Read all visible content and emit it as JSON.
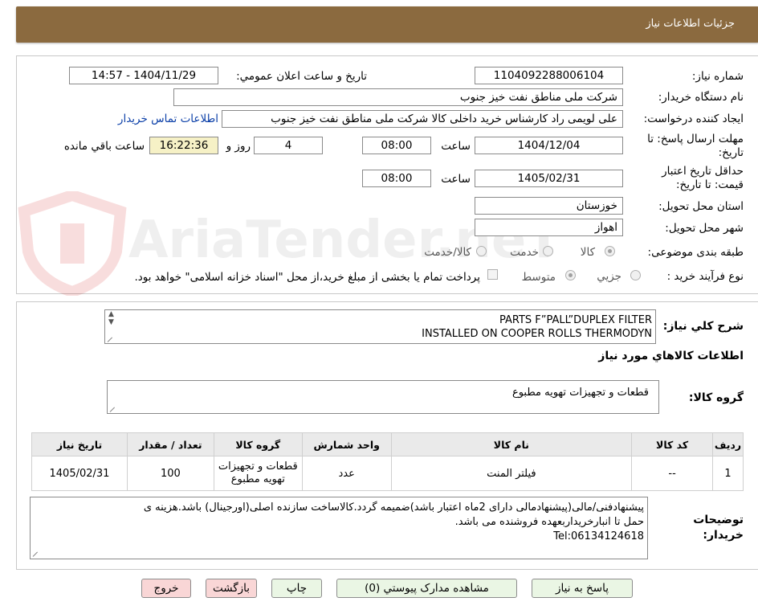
{
  "header": {
    "title": "جزئيات اطلاعات نياز"
  },
  "form": {
    "need_number": {
      "label": "شماره نياز:",
      "value": "1104092288006104"
    },
    "announce": {
      "label": "تاريخ و ساعت اعلان عمومي:",
      "value": "1404/11/29 - 14:57"
    },
    "buyer_org": {
      "label": "نام دستگاه خريدار:",
      "value": "شرکت ملی مناطق نفت خیز جنوب"
    },
    "requester": {
      "label": "ايجاد کننده درخواست:",
      "value": "علی  لویمی راد  کارشناس خرید داخلی کالا شرکت ملی مناطق نفت خیز جنوب",
      "contact_link": "اطلاعات تماس خريدار"
    },
    "deadline": {
      "label": "مهلت ارسال پاسخ: تا تاريخ:",
      "date": "1404/12/04",
      "time_label": "ساعت",
      "time": "08:00",
      "days": "4",
      "days_label": "روز و",
      "remaining": "16:22:36",
      "remaining_label": "ساعت باقي مانده"
    },
    "validity": {
      "label": "حداقل تاريخ اعتبار قيمت: تا تاريخ:",
      "date": "1405/02/31",
      "time_label": "ساعت",
      "time": "08:00"
    },
    "province": {
      "label": "استان محل تحويل:",
      "value": "خوزستان"
    },
    "city": {
      "label": "شهر محل تحويل:",
      "value": "اهواز"
    },
    "category": {
      "label": "طبقه بندی موضوعی:",
      "options": [
        "کالا",
        "خدمت",
        "کالا/خدمت"
      ],
      "selected": "کالا"
    },
    "process": {
      "label": "نوع فرآيند خريد :",
      "options": [
        "جزيي",
        "متوسط"
      ],
      "selected": "متوسط",
      "note": "پرداخت تمام يا بخشی از مبلغ خريد،از محل \"اسناد خزانه اسلامی\" خواهد بود."
    }
  },
  "summary": {
    "label": "شرح کلي نياز:",
    "lines": [
      "PARTS F”PALL”DUPLEX FILTER",
      "INSTALLED ON COOPER ROLLS THERMODYN"
    ]
  },
  "goods": {
    "title": "اطلاعات کالاهاي مورد نياز",
    "group_label": "گروه کالا:",
    "group_value": "قطعات و تجهیزات تهویه مطبوع",
    "columns": [
      "رديف",
      "کد کالا",
      "نام کالا",
      "واحد شمارش",
      "گروه کالا",
      "تعداد / مقدار",
      "تاريخ نياز"
    ],
    "rows": [
      {
        "row": "1",
        "code": "--",
        "name": "فیلتر المنت",
        "unit": "عدد",
        "group": "قطعات و تجهیزات تهویه مطبوع",
        "qty": "100",
        "date": "1405/02/31"
      }
    ]
  },
  "notes": {
    "label": "توضيحات خريدار:",
    "lines": [
      "پیشنهادفنی/مالی(پیشنهادمالی دارای 2ماه اعتبار باشد)ضمیمه گردد.کالاساخت سازنده اصلی(اورجینال) باشد.هزینه ی",
      "حمل تا انبارخریداربعهده فروشنده می باشد.",
      "Tel:06134124618"
    ]
  },
  "buttons": {
    "reply": "پاسخ به نياز",
    "attachments": "مشاهده مدارک پيوستي (0)",
    "print": "چاپ",
    "back": "بازگشت",
    "exit": "خروج"
  },
  "watermark": {
    "text": "AriaTender.neT"
  },
  "colors": {
    "header": "#8b6a3f",
    "remaining_bg": "#f6f1c6",
    "link": "#0b3fa8"
  }
}
